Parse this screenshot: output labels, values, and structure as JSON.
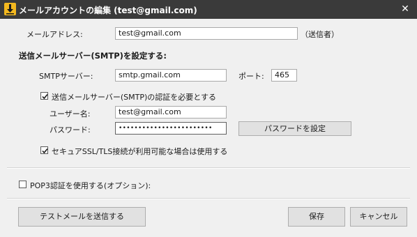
{
  "window": {
    "title": "メールアカウントの編集 (test@gmail.com)",
    "close_glyph": "✕"
  },
  "email": {
    "label": "メールアドレス:",
    "value": "test@gmail.com",
    "note": "（送信者）"
  },
  "smtp": {
    "section_title": "送信メールサーバー(SMTP)を設定する:",
    "server_label": "SMTPサーバー:",
    "server_value": "smtp.gmail.com",
    "port_label": "ポート:",
    "port_value": "465",
    "auth_checkbox_label": "送信メールサーバー(SMTP)の認証を必要とする",
    "auth_checked": true,
    "username_label": "ユーザー名:",
    "username_value": "test@gmail.com",
    "password_label": "パスワード:",
    "password_value": "••••••••••••••••••••••••",
    "set_password_button": "パスワードを設定",
    "ssl_checkbox_label": "セキュアSSL/TLS接続が利用可能な場合は使用する",
    "ssl_checked": true
  },
  "pop3": {
    "checkbox_label": "POP3認証を使用する(オプション):",
    "checked": false
  },
  "footer": {
    "test_button": "テストメールを送信する",
    "save_button": "保存",
    "cancel_button": "キャンセル"
  },
  "colors": {
    "titlebar": "#3a3a3a",
    "app_icon": "#f3b81f",
    "background": "#f0f0f0",
    "button_face": "#e1e1e1"
  }
}
